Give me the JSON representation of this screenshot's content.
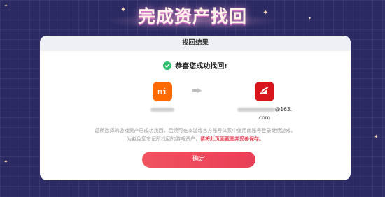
{
  "header": {
    "title": "完成资产找回"
  },
  "card": {
    "title": "找回结果",
    "success_text": "恭喜您成功找回!",
    "source_account": {
      "icon": "xiaomi-logo-icon",
      "icon_text": "mi",
      "name_visible": ""
    },
    "target_account": {
      "icon": "game-app-icon",
      "name_suffix": "@163.",
      "name_line2": "com"
    },
    "note_line1": "您所选择的游戏资产已成功找回，后续可在本游戏官方账号体系中使用此账号登录继续游戏。",
    "note_line2_normal": "为避免您忘记所找回的游戏资产，",
    "note_line2_emphasis": "请将此页面截图并妥善保存。",
    "confirm_label": "确定"
  },
  "colors": {
    "background": "#2c2a63",
    "accent": "#ea3e57",
    "success": "#2fbf6f",
    "xiaomi": "#ff6a00",
    "app2": "#d8141c"
  }
}
